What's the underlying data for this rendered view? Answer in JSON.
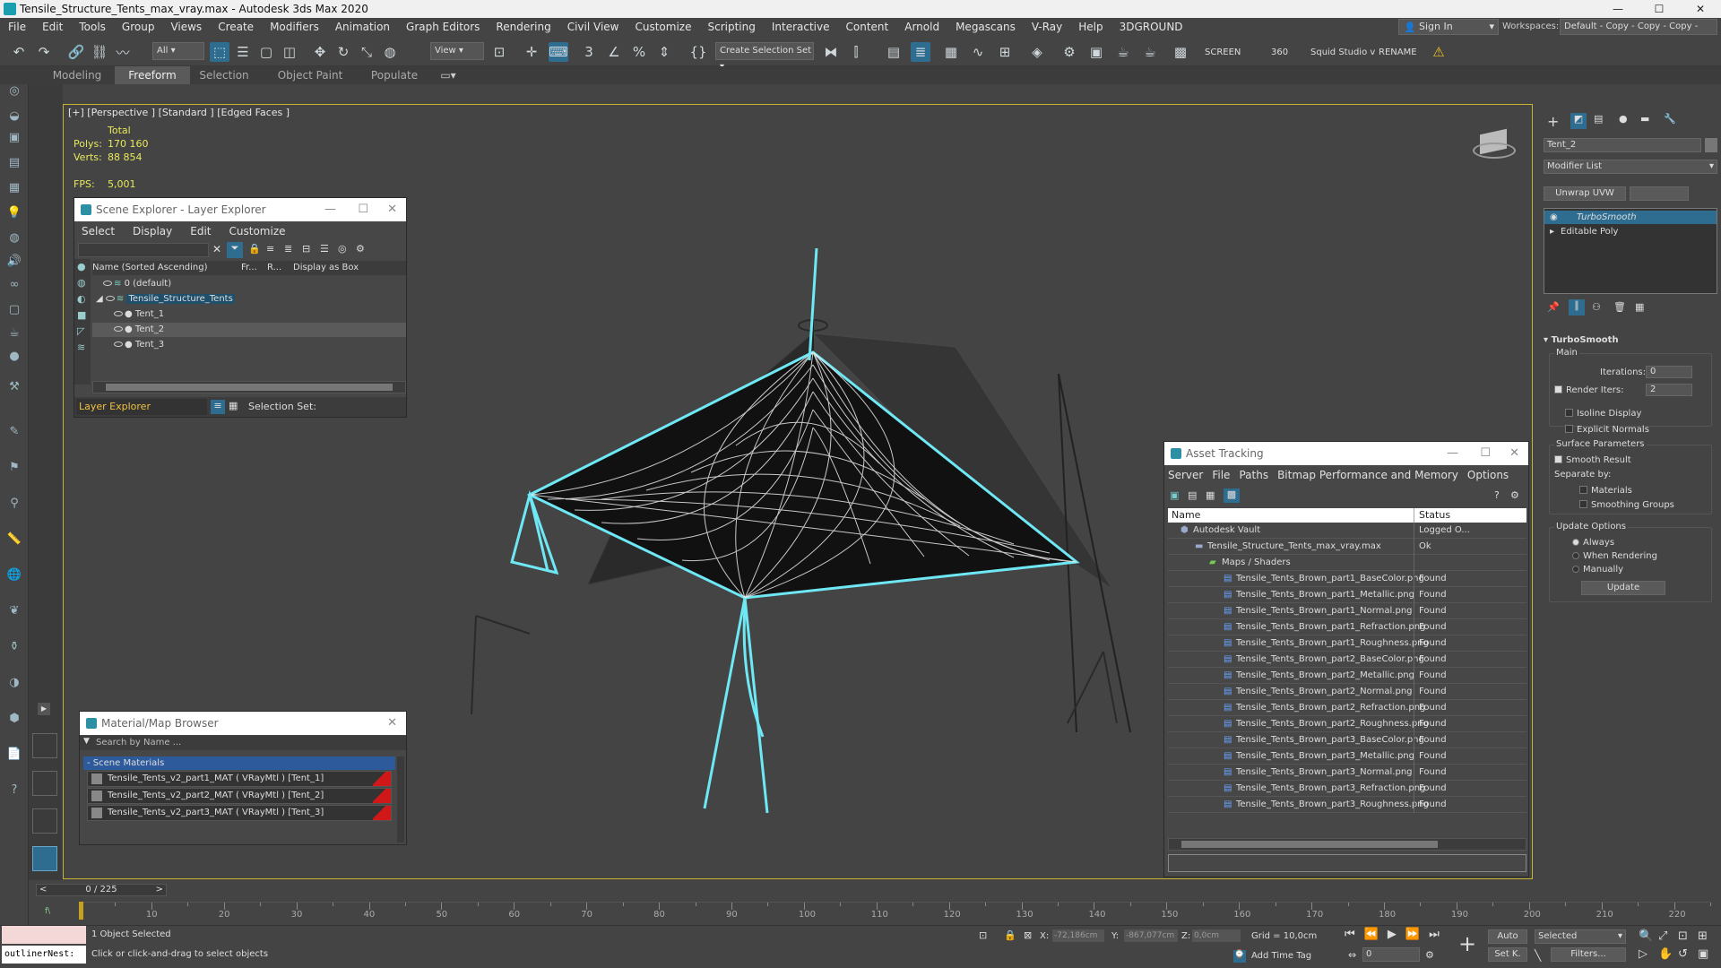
{
  "titlebar": {
    "title": "Tensile_Structure_Tents_max_vray.max - Autodesk 3ds Max 2020",
    "controls": [
      "—",
      "☐",
      "✕"
    ]
  },
  "menu": [
    "File",
    "Edit",
    "Tools",
    "Group",
    "Views",
    "Create",
    "Modifiers",
    "Animation",
    "Graph Editors",
    "Rendering",
    "Civil View",
    "Customize",
    "Scripting",
    "Interactive",
    "Content",
    "Arnold",
    "Megascans",
    "V-Ray",
    "Help",
    "3DGROUND"
  ],
  "signin": "Sign In",
  "workspaces": {
    "label": "Workspaces:",
    "value": "Default - Copy - Copy - Copy - Copy"
  },
  "toolbar": {
    "filter": "All",
    "view": "View",
    "selection_set": "Create Selection Set",
    "screen": "SCREEN",
    "value360": "360",
    "squid": "Squid Studio v",
    "rename": "RENAME"
  },
  "ribbon_tabs": [
    "Modeling",
    "Freeform",
    "Selection",
    "Object Paint",
    "Populate"
  ],
  "viewport": {
    "label": "[+] [Perspective ] [Standard ] [Edged Faces ]",
    "stats": {
      "total": "Total",
      "polys_label": "Polys:",
      "polys": "170 160",
      "verts_label": "Verts:",
      "verts": "88 854",
      "fps_label": "FPS:",
      "fps": "5,001"
    }
  },
  "scene_explorer": {
    "title": "Scene Explorer - Layer Explorer",
    "menu": [
      "Select",
      "Display",
      "Edit",
      "Customize"
    ],
    "columns": [
      "Name (Sorted Ascending)",
      "Fr...",
      "R...",
      "Display as Box"
    ],
    "rows": [
      {
        "name": "0 (default)",
        "level": 0
      },
      {
        "name": "Tensile_Structure_Tents",
        "level": 0
      },
      {
        "name": "Tent_1",
        "level": 1
      },
      {
        "name": "Tent_2",
        "level": 1
      },
      {
        "name": "Tent_3",
        "level": 1
      }
    ],
    "footer_layer": "Layer Explorer",
    "footer_selset": "Selection Set:"
  },
  "material_browser": {
    "title": "Material/Map Browser",
    "search_placeholder": "Search by Name ...",
    "section": "- Scene Materials",
    "items": [
      "Tensile_Tents_v2_part1_MAT  ( VRayMtl )  [Tent_1]",
      "Tensile_Tents_v2_part2_MAT  ( VRayMtl )  [Tent_2]",
      "Tensile_Tents_v2_part3_MAT  ( VRayMtl )  [Tent_3]"
    ]
  },
  "asset_tracking": {
    "title": "Asset Tracking",
    "menu": [
      "Server",
      "File",
      "Paths",
      "Bitmap Performance and Memory",
      "Options"
    ],
    "columns": [
      "Name",
      "Status"
    ],
    "rows": [
      {
        "name": "Autodesk Vault",
        "status": "Logged O...",
        "level": 0
      },
      {
        "name": "Tensile_Structure_Tents_max_vray.max",
        "status": "Ok",
        "level": 1
      },
      {
        "name": "Maps / Shaders",
        "status": "",
        "level": 2
      },
      {
        "name": "Tensile_Tents_Brown_part1_BaseColor.png",
        "status": "Found",
        "level": 3
      },
      {
        "name": "Tensile_Tents_Brown_part1_Metallic.png",
        "status": "Found",
        "level": 3
      },
      {
        "name": "Tensile_Tents_Brown_part1_Normal.png",
        "status": "Found",
        "level": 3
      },
      {
        "name": "Tensile_Tents_Brown_part1_Refraction.png",
        "status": "Found",
        "level": 3
      },
      {
        "name": "Tensile_Tents_Brown_part1_Roughness.png",
        "status": "Found",
        "level": 3
      },
      {
        "name": "Tensile_Tents_Brown_part2_BaseColor.png",
        "status": "Found",
        "level": 3
      },
      {
        "name": "Tensile_Tents_Brown_part2_Metallic.png",
        "status": "Found",
        "level": 3
      },
      {
        "name": "Tensile_Tents_Brown_part2_Normal.png",
        "status": "Found",
        "level": 3
      },
      {
        "name": "Tensile_Tents_Brown_part2_Refraction.png",
        "status": "Found",
        "level": 3
      },
      {
        "name": "Tensile_Tents_Brown_part2_Roughness.png",
        "status": "Found",
        "level": 3
      },
      {
        "name": "Tensile_Tents_Brown_part3_BaseColor.png",
        "status": "Found",
        "level": 3
      },
      {
        "name": "Tensile_Tents_Brown_part3_Metallic.png",
        "status": "Found",
        "level": 3
      },
      {
        "name": "Tensile_Tents_Brown_part3_Normal.png",
        "status": "Found",
        "level": 3
      },
      {
        "name": "Tensile_Tents_Brown_part3_Refraction.png",
        "status": "Found",
        "level": 3
      },
      {
        "name": "Tensile_Tents_Brown_part3_Roughness.png",
        "status": "Found",
        "level": 3
      }
    ]
  },
  "command_panel": {
    "object_name": "Tent_2",
    "modifier_list": "Modifier List",
    "unwrap_button": "Unwrap UVW",
    "stack": [
      "TurboSmooth",
      "Editable Poly"
    ],
    "rollout_title": "TurboSmooth",
    "main": "Main",
    "iterations_label": "Iterations:",
    "iterations": "0",
    "render_iters_label": "Render Iters:",
    "render_iters": "2",
    "isoline": "Isoline Display",
    "explicit": "Explicit Normals",
    "surface_params": "Surface Parameters",
    "smooth_result": "Smooth Result",
    "separate_by": "Separate by:",
    "materials": "Materials",
    "smoothing_groups": "Smoothing Groups",
    "update_options": "Update Options",
    "always": "Always",
    "when_rendering": "When Rendering",
    "manually": "Manually",
    "update_button": "Update"
  },
  "timeline": {
    "frame": "0 / 225",
    "ticks": [
      "10",
      "20",
      "30",
      "40",
      "50",
      "60",
      "70",
      "80",
      "90",
      "100",
      "110",
      "120",
      "130",
      "140",
      "150",
      "160",
      "170",
      "180",
      "190",
      "200",
      "210",
      "220"
    ]
  },
  "status": {
    "script_box": "outlinerNest:",
    "selected": "1 Object Selected",
    "prompt": "Click or click-and-drag to select objects",
    "x_label": "X:",
    "x": "-72,186cm",
    "y_label": "Y:",
    "y": "-867,077cm",
    "z_label": "Z:",
    "z": "0,0cm",
    "grid": "Grid = 10,0cm",
    "add_time_tag": "Add Time Tag",
    "auto": "Auto",
    "selected_dd": "Selected",
    "setk": "Set K.",
    "filters": "Filters...",
    "frame_field": "0"
  },
  "colors": {
    "accent": "#2e6d90",
    "selection": "#6fe8f5",
    "viewport_border": "#c8b232",
    "stats": "#e8e85a"
  }
}
